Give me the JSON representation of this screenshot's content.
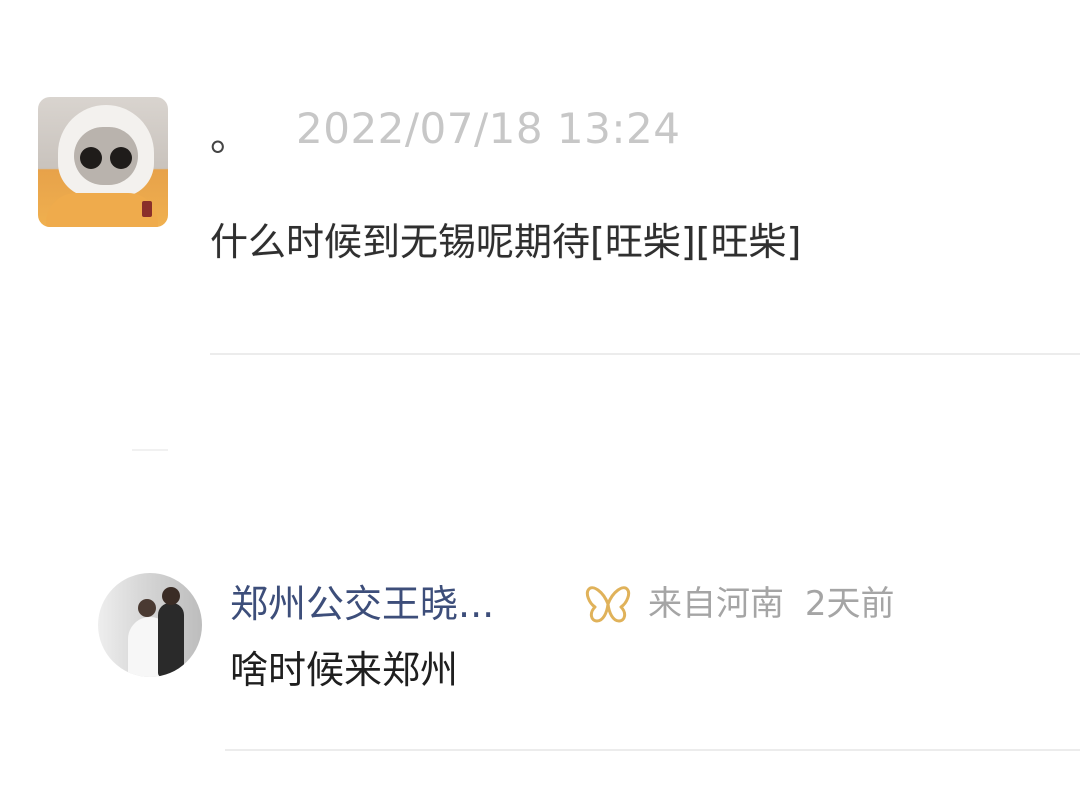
{
  "comments": [
    {
      "author": "。",
      "time": "2022/07/18 13:24",
      "text": "什么时候到无锡呢期待[旺柴][旺柴]"
    },
    {
      "author": "郑州公交王晓...",
      "location": "来自河南",
      "ago": "2天前",
      "text": "啥时候来郑州",
      "member_icon": "butterfly-vip-icon",
      "accent_color": "#e0b25a",
      "name_color": "#3d4e7a"
    }
  ]
}
